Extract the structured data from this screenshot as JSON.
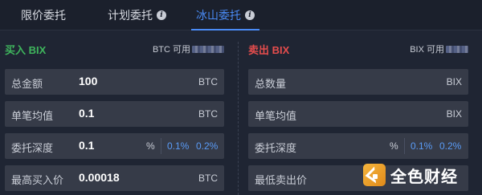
{
  "tabs": [
    {
      "label": "限价委托",
      "active": false,
      "info": false
    },
    {
      "label": "计划委托",
      "active": false,
      "info": true
    },
    {
      "label": "冰山委托",
      "active": true,
      "info": true
    }
  ],
  "buy": {
    "title": "买入 BIX",
    "available_label": "BTC 可用",
    "rows": [
      {
        "label": "总金额",
        "value": "100",
        "unit": "BTC"
      },
      {
        "label": "单笔均值",
        "value": "0.1",
        "unit": "BTC"
      },
      {
        "label": "委托深度",
        "value": "0.1",
        "unit": "%",
        "quick": [
          "0.1%",
          "0.2%"
        ]
      },
      {
        "label": "最高买入价",
        "value": "0.00018",
        "unit": "BTC"
      }
    ]
  },
  "sell": {
    "title": "卖出 BIX",
    "available_label": "BIX 可用",
    "rows": [
      {
        "label": "总数量",
        "value": "",
        "unit": "BIX"
      },
      {
        "label": "单笔均值",
        "value": "",
        "unit": "BIX"
      },
      {
        "label": "委托深度",
        "value": "",
        "unit": "%",
        "quick": [
          "0.1%",
          "0.2%"
        ]
      },
      {
        "label": "最低卖出价",
        "value": "",
        "unit": ""
      }
    ]
  },
  "watermark": {
    "text": "全色财经"
  },
  "colors": {
    "accent": "#4a8bf5",
    "buy": "#3fb65d",
    "sell": "#e64d4d",
    "quick": "#5a9bf6"
  },
  "icons": {
    "info": "info-icon",
    "logo": "jinse-logo-icon"
  }
}
